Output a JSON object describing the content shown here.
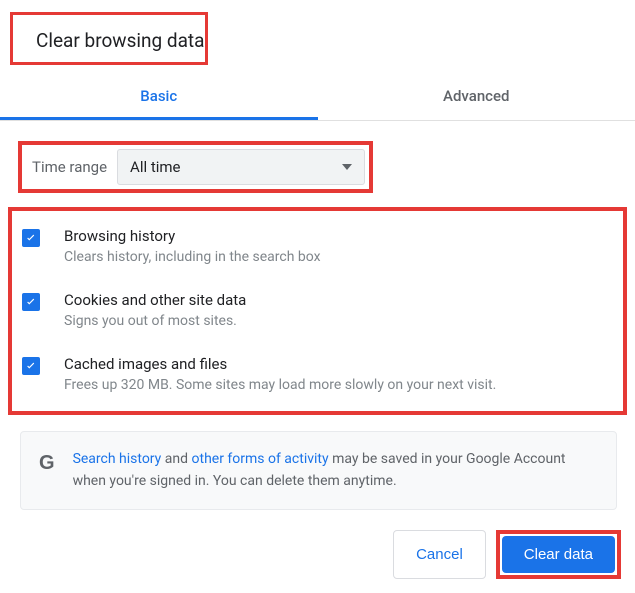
{
  "dialog": {
    "title": "Clear browsing data"
  },
  "tabs": {
    "basic": "Basic",
    "advanced": "Advanced"
  },
  "timeRange": {
    "label": "Time range",
    "value": "All time"
  },
  "items": [
    {
      "title": "Browsing history",
      "desc": "Clears history, including in the search box"
    },
    {
      "title": "Cookies and other site data",
      "desc": "Signs you out of most sites."
    },
    {
      "title": "Cached images and files",
      "desc": "Frees up 320 MB. Some sites may load more slowly on your next visit."
    }
  ],
  "info": {
    "link1": "Search history",
    "mid1": " and ",
    "link2": "other forms of activity",
    "rest": " may be saved in your Google Account when you're signed in. You can delete them anytime."
  },
  "buttons": {
    "cancel": "Cancel",
    "clear": "Clear data"
  }
}
